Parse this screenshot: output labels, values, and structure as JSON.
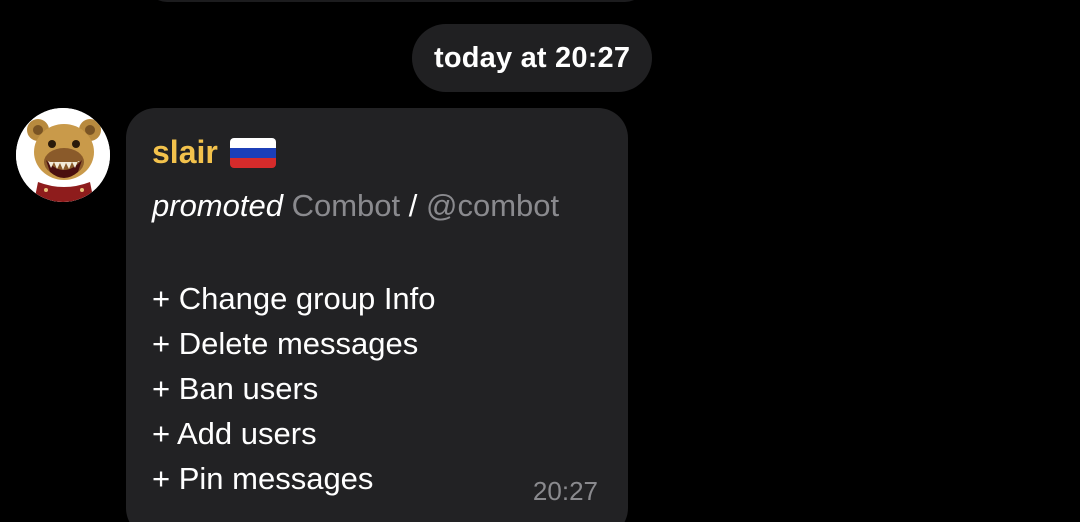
{
  "date_separator": "today at 20:27",
  "message": {
    "sender": {
      "name": "slair",
      "flag_icon": "russia-flag-icon",
      "name_color": "#f3c24c"
    },
    "promoted_word": "promoted",
    "bot_name": "Combot",
    "separator": "/",
    "bot_handle": "@combot",
    "permissions": [
      "+ Change group Info",
      "+ Delete messages",
      "+ Ban users",
      "+ Add users",
      "+ Pin messages"
    ],
    "time": "20:27"
  },
  "colors": {
    "background": "#000000",
    "bubble": "#222224",
    "muted_text": "#8a8a8e"
  }
}
